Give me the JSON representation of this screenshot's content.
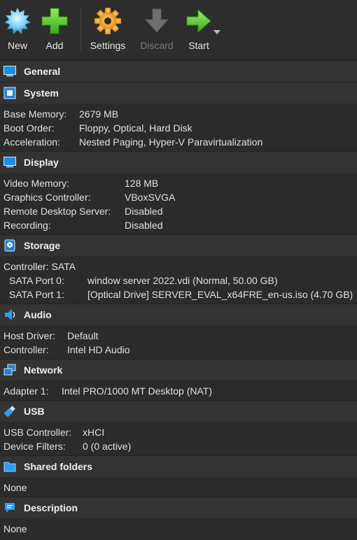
{
  "toolbar": {
    "new_label": "New",
    "add_label": "Add",
    "settings_label": "Settings",
    "discard_label": "Discard",
    "start_label": "Start"
  },
  "sections": {
    "general": {
      "title": "General"
    },
    "system": {
      "title": "System",
      "rows": [
        {
          "key": "Base Memory:",
          "value": "2679 MB"
        },
        {
          "key": "Boot Order:",
          "value": "Floppy, Optical, Hard Disk"
        },
        {
          "key": "Acceleration:",
          "value": "Nested Paging, Hyper-V Paravirtualization"
        }
      ]
    },
    "display": {
      "title": "Display",
      "rows": [
        {
          "key": "Video Memory:",
          "value": "128 MB"
        },
        {
          "key": "Graphics Controller:",
          "value": "VBoxSVGA"
        },
        {
          "key": "Remote Desktop Server:",
          "value": "Disabled"
        },
        {
          "key": "Recording:",
          "value": "Disabled"
        }
      ]
    },
    "storage": {
      "title": "Storage",
      "controller": "Controller: SATA",
      "rows": [
        {
          "key": "SATA Port 0:",
          "value": "window server 2022.vdi (Normal, 50.00 GB)"
        },
        {
          "key": "SATA Port 1:",
          "value": "[Optical Drive] SERVER_EVAL_x64FRE_en-us.iso (4.70 GB)"
        }
      ]
    },
    "audio": {
      "title": "Audio",
      "rows": [
        {
          "key": "Host Driver:",
          "value": "Default"
        },
        {
          "key": "Controller:",
          "value": "Intel HD Audio"
        }
      ]
    },
    "network": {
      "title": "Network",
      "rows": [
        {
          "key": "Adapter 1:",
          "value": "Intel PRO/1000 MT Desktop (NAT)"
        }
      ]
    },
    "usb": {
      "title": "USB",
      "rows": [
        {
          "key": "USB Controller:",
          "value": "xHCI"
        },
        {
          "key": "Device Filters:",
          "value": "0 (0 active)"
        }
      ]
    },
    "shared_folders": {
      "title": "Shared folders",
      "value": "None"
    },
    "description": {
      "title": "Description",
      "value": "None"
    }
  }
}
